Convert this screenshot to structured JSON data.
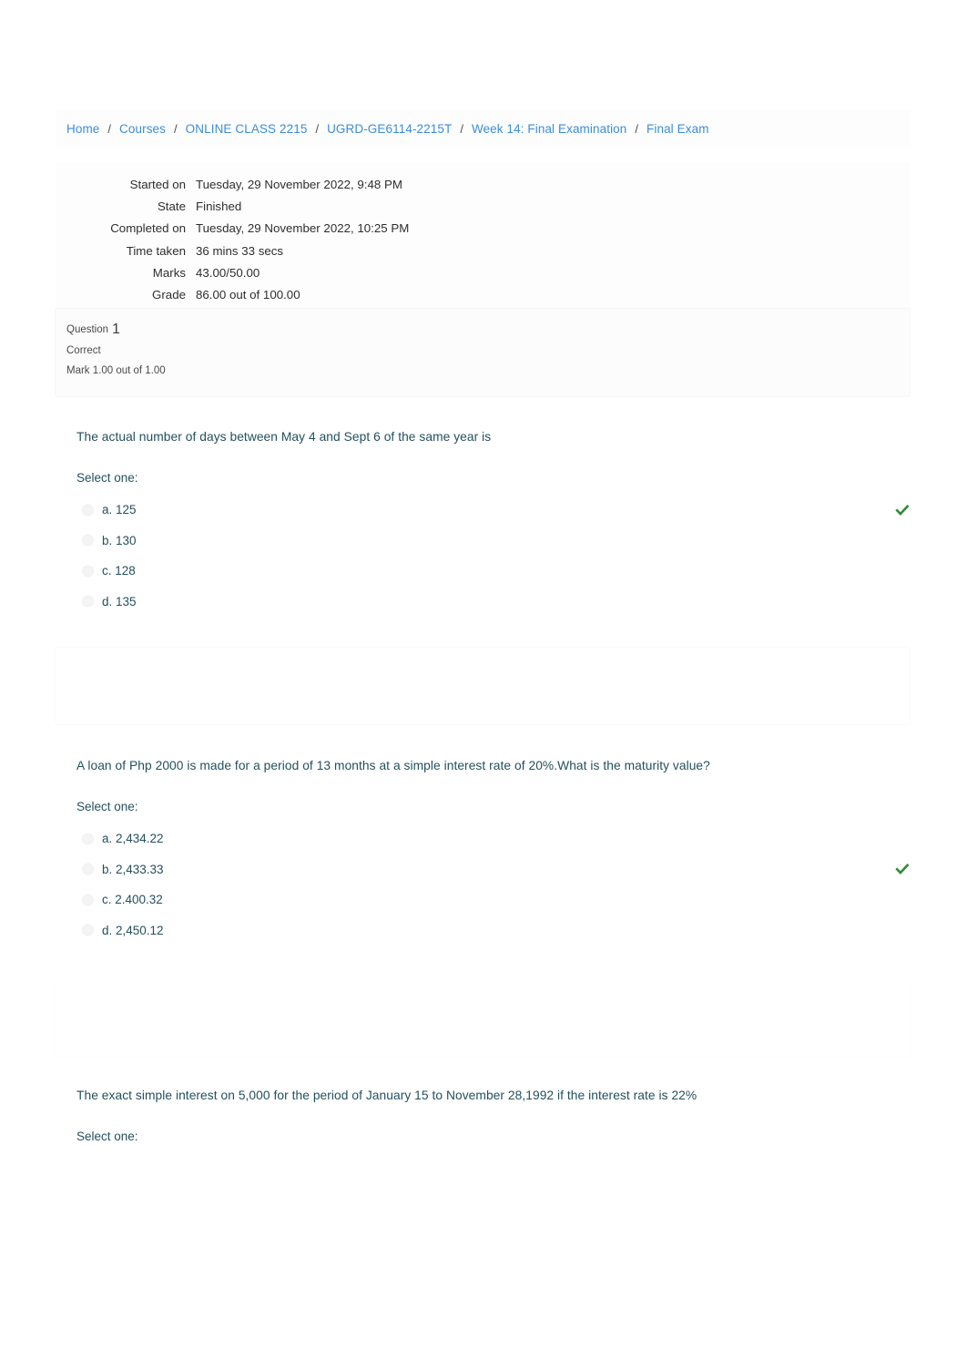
{
  "breadcrumb": {
    "separator": "/",
    "items": [
      {
        "label": "Home"
      },
      {
        "label": "Courses"
      },
      {
        "label": "ONLINE CLASS 2215"
      },
      {
        "label": "UGRD-GE6114-2215T"
      },
      {
        "label": "Week 14: Final Examination"
      },
      {
        "label": "Final Exam"
      }
    ]
  },
  "summary": {
    "rows": [
      {
        "label": "Started on",
        "value": "Tuesday, 29 November 2022, 9:48 PM"
      },
      {
        "label": "State",
        "value": "Finished"
      },
      {
        "label": "Completed on",
        "value": "Tuesday, 29 November 2022, 10:25 PM"
      },
      {
        "label": "Time taken",
        "value": "36 mins 33 secs"
      },
      {
        "label": "Marks",
        "value": "43.00/50.00"
      },
      {
        "label": "Grade",
        "value": "86.00 out of 100.00"
      }
    ]
  },
  "questions": [
    {
      "info": {
        "question_word": "Question",
        "number": "1",
        "state": "Correct",
        "mark": "Mark 1.00 out of 1.00"
      },
      "text": "The actual number of days between May 4 and Sept 6 of the same year is",
      "select_one_label": "Select one:",
      "options": [
        {
          "label": "a. 125",
          "correct": true
        },
        {
          "label": "b. 130",
          "correct": false
        },
        {
          "label": "c. 128",
          "correct": false
        },
        {
          "label": "d. 135",
          "correct": false
        }
      ]
    },
    {
      "info": {
        "question_word": "",
        "number": "",
        "state": "",
        "mark": ""
      },
      "text": "A loan of Php 2000 is made for a period of 13 months at a simple interest rate of 20%.What is the maturity value?",
      "select_one_label": "Select one:",
      "options": [
        {
          "label": "a. 2,434.22",
          "correct": false
        },
        {
          "label": "b. 2,433.33",
          "correct": true
        },
        {
          "label": "c. 2.400.32",
          "correct": false
        },
        {
          "label": "d. 2,450.12",
          "correct": false
        }
      ]
    },
    {
      "info": {
        "question_word": "",
        "number": "",
        "state": "",
        "mark": ""
      },
      "text": "The exact simple interest on 5,000 for the period of January 15 to November 28,1992 if the interest rate is 22%",
      "select_one_label": "Select one:",
      "options": []
    }
  ],
  "colors": {
    "link": "#3a8ddb",
    "question_text": "#24505f",
    "correct_tick": "#2f8b36",
    "body_text": "#2e2e2e"
  },
  "icons": {
    "correct": "check-icon"
  }
}
